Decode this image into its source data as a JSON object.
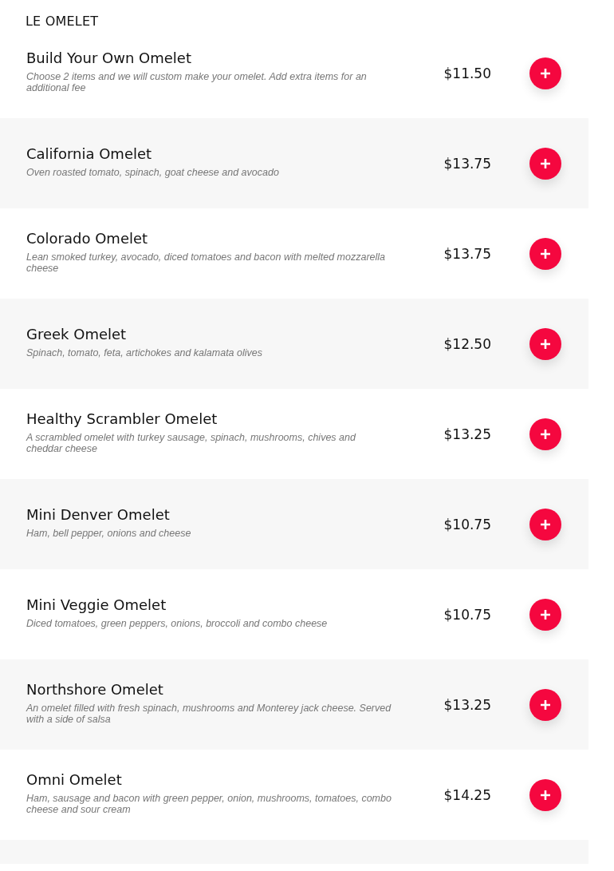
{
  "section_title": "LE OMELET",
  "items": [
    {
      "name": "Build Your Own Omelet",
      "description": "Choose 2 items and we will custom make your omelet. Add extra items for an additional fee",
      "price": "$11.50"
    },
    {
      "name": "California Omelet",
      "description": "Oven roasted tomato, spinach, goat cheese and avocado",
      "price": "$13.75"
    },
    {
      "name": "Colorado Omelet",
      "description": "Lean smoked turkey, avocado, diced tomatoes and bacon with melted mozzarella cheese",
      "price": "$13.75"
    },
    {
      "name": "Greek Omelet",
      "description": "Spinach, tomato, feta, artichokes and kalamata olives",
      "price": "$12.50"
    },
    {
      "name": "Healthy Scrambler Omelet",
      "description": "A scrambled omelet with turkey sausage, spinach, mushrooms, chives and cheddar cheese",
      "price": "$13.25"
    },
    {
      "name": "Mini Denver Omelet",
      "description": "Ham, bell pepper, onions and cheese",
      "price": "$10.75"
    },
    {
      "name": "Mini Veggie Omelet",
      "description": "Diced tomatoes, green peppers, onions, broccoli and combo cheese",
      "price": "$10.75"
    },
    {
      "name": "Northshore Omelet",
      "description": "An omelet filled with fresh spinach, mushrooms and Monterey jack cheese. Served with a side of salsa",
      "price": "$13.25"
    },
    {
      "name": "Omni Omelet",
      "description": "Ham, sausage and bacon with green pepper, onion, mushrooms, tomatoes, combo cheese and sour cream",
      "price": "$14.25"
    }
  ]
}
